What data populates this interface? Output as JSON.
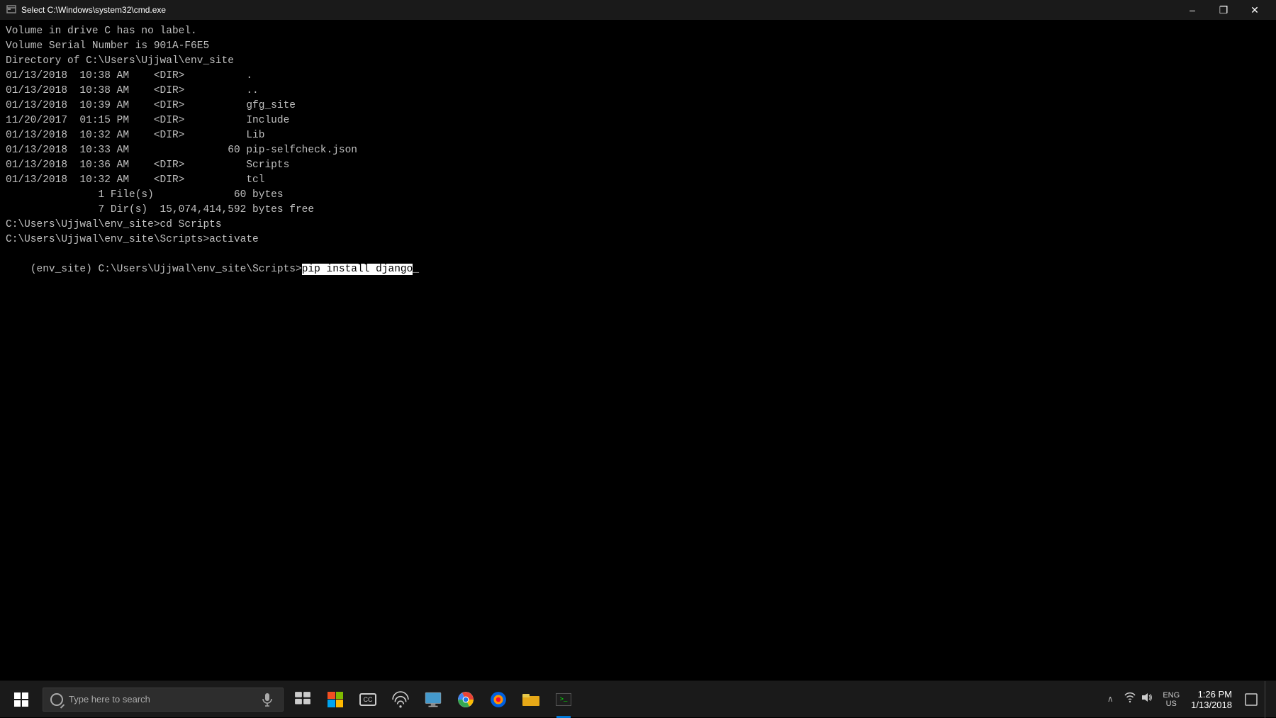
{
  "titlebar": {
    "title": "Select C:\\Windows\\system32\\cmd.exe",
    "minimize_label": "–",
    "restore_label": "❐",
    "close_label": "✕"
  },
  "terminal": {
    "lines": [
      "Volume in drive C has no label.",
      "Volume Serial Number is 901A-F6E5",
      "",
      "Directory of C:\\Users\\Ujjwal\\env_site",
      "",
      "01/13/2018  10:38 AM    <DIR>          .",
      "01/13/2018  10:38 AM    <DIR>          ..",
      "01/13/2018  10:39 AM    <DIR>          gfg_site",
      "11/20/2017  01:15 PM    <DIR>          Include",
      "01/13/2018  10:32 AM    <DIR>          Lib",
      "01/13/2018  10:33 AM                60 pip-selfcheck.json",
      "01/13/2018  10:36 AM    <DIR>          Scripts",
      "01/13/2018  10:32 AM    <DIR>          tcl",
      "               1 File(s)             60 bytes",
      "               7 Dir(s)  15,074,414,592 bytes free",
      "",
      "C:\\Users\\Ujjwal\\env_site>cd Scripts",
      "",
      "C:\\Users\\Ujjwal\\env_site\\Scripts>activate",
      ""
    ],
    "current_line_prefix": "(env_site) C:\\Users\\Ujjwal\\env_site\\Scripts>",
    "current_command": "pip install django",
    "cursor": "_"
  },
  "taskbar": {
    "search_placeholder": "Type here to search",
    "time": "1:26 PM",
    "date": "1/13/2018",
    "icons": [
      {
        "name": "task-view",
        "label": "Task View"
      },
      {
        "name": "windows-store",
        "label": "Store"
      },
      {
        "name": "closed-captions",
        "label": "CC"
      },
      {
        "name": "connect",
        "label": "Connect"
      },
      {
        "name": "pc-settings",
        "label": "PC Settings"
      },
      {
        "name": "chrome",
        "label": "Google Chrome"
      },
      {
        "name": "firefox",
        "label": "Firefox"
      },
      {
        "name": "file-explorer",
        "label": "File Explorer"
      },
      {
        "name": "cmd",
        "label": "Command Prompt"
      }
    ],
    "sys_tray": {
      "chevron": "^",
      "network": "wifi",
      "lang_line1": "ENG",
      "lang_line2": "US"
    }
  }
}
